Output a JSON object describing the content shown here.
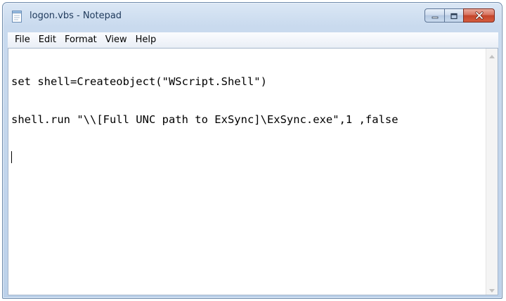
{
  "window": {
    "title": "logon.vbs - Notepad"
  },
  "menu": {
    "items": [
      "File",
      "Edit",
      "Format",
      "View",
      "Help"
    ]
  },
  "editor": {
    "lines": [
      "set shell=Createobject(\"WScript.Shell\")",
      "shell.run \"\\\\[Full UNC path to ExSync]\\ExSync.exe\",1 ,false",
      ""
    ]
  },
  "icons": {
    "app": "notepad-icon",
    "minimize": "minimize-icon",
    "maximize": "maximize-icon",
    "close": "close-icon",
    "scroll_up": "scroll-up-arrow-icon",
    "scroll_down": "scroll-down-arrow-icon"
  },
  "colors": {
    "title_text": "#1e395b",
    "close_button": "#c4452b",
    "frame": "#bcd1ea"
  }
}
